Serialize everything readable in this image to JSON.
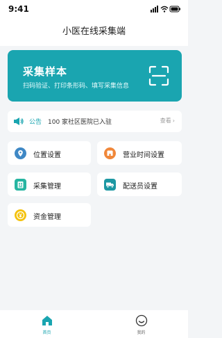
{
  "status_bar": {
    "time": "9:41"
  },
  "header": {
    "title": "小医在线采集端"
  },
  "hero": {
    "title": "采集样本",
    "subtitle": "扫码验证、打印条形码、填写采集信息"
  },
  "notice": {
    "tag": "公告",
    "text": "100 家社区医院已入驻",
    "more": "查看",
    "more_arrow": "›"
  },
  "menu": {
    "location": "位置设置",
    "hours": "营业时间设置",
    "collection": "采集管理",
    "courier": "配送员设置",
    "funds": "资金管理"
  },
  "tabbar": {
    "home": "首页",
    "mine": "我的"
  },
  "colors": {
    "accent": "#1aa5b0",
    "location": "#3f88c5",
    "hours": "#f0873a",
    "collection": "#26b5a1",
    "courier": "#1d98a3",
    "funds": "#f4c20d"
  }
}
